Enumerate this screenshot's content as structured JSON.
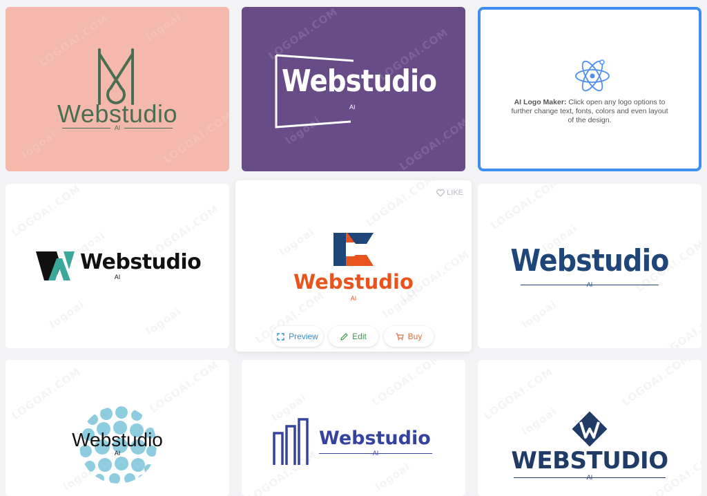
{
  "brand": "Webstudio",
  "brand_upper": "WEBSTUDIO",
  "suffix": "AI",
  "watermark": "LOGOAI.COM",
  "watermark_small": "logoai",
  "info": {
    "title": "AI Logo Maker:",
    "text": "Click open any logo options to further change text, fonts, colors and even layout of the design."
  },
  "actions": {
    "like": "LIKE",
    "preview": "Preview",
    "edit": "Edit",
    "buy": "Buy"
  },
  "colors": {
    "pink_bg": "#f4b9ac",
    "purple_bg": "#684c88",
    "green": "#4a6e52",
    "orange": "#e8541e",
    "navy": "#1f4678",
    "teal": "#3aa89a",
    "royal": "#3543a0",
    "sphere": "#8ecde0",
    "info_border": "#3d8ef0",
    "preview": "#2f8fd6",
    "edit": "#3a9a4a",
    "buy": "#e06a3c"
  },
  "icons": [
    "atom-icon",
    "heart-icon",
    "expand-icon",
    "pencil-icon",
    "cart-icon"
  ]
}
